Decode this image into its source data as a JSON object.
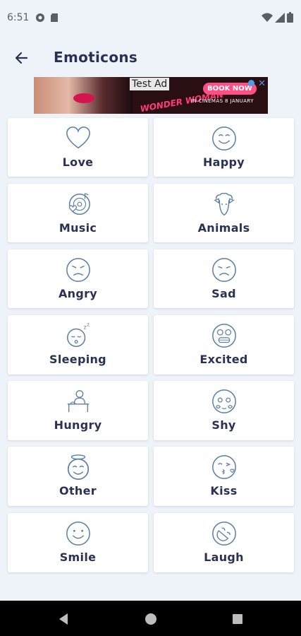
{
  "status_bar": {
    "time": "6:51"
  },
  "header": {
    "title": "Emoticons"
  },
  "ad": {
    "tag": "Test Ad",
    "headline": "WONDER WOMAN",
    "cta": "BOOK NOW",
    "subline": "IN CINEMAS 8 JANUARY"
  },
  "categories": [
    {
      "label": "Love",
      "icon": "heart-icon"
    },
    {
      "label": "Happy",
      "icon": "happy-face-icon"
    },
    {
      "label": "Music",
      "icon": "music-vinyl-icon"
    },
    {
      "label": "Animals",
      "icon": "sheep-icon"
    },
    {
      "label": "Angry",
      "icon": "angry-face-icon"
    },
    {
      "label": "Sad",
      "icon": "sad-face-icon"
    },
    {
      "label": "Sleeping",
      "icon": "sleeping-face-icon"
    },
    {
      "label": "Excited",
      "icon": "excited-face-icon"
    },
    {
      "label": "Hungry",
      "icon": "hungry-person-icon"
    },
    {
      "label": "Shy",
      "icon": "shy-face-icon"
    },
    {
      "label": "Other",
      "icon": "angel-face-icon"
    },
    {
      "label": "Kiss",
      "icon": "kiss-face-icon"
    },
    {
      "label": "Smile",
      "icon": "smile-face-icon"
    },
    {
      "label": "Laugh",
      "icon": "laugh-face-icon"
    }
  ],
  "colors": {
    "background": "#eef3fa",
    "icon_stroke": "#5b7fa6",
    "text": "#2b3154"
  }
}
